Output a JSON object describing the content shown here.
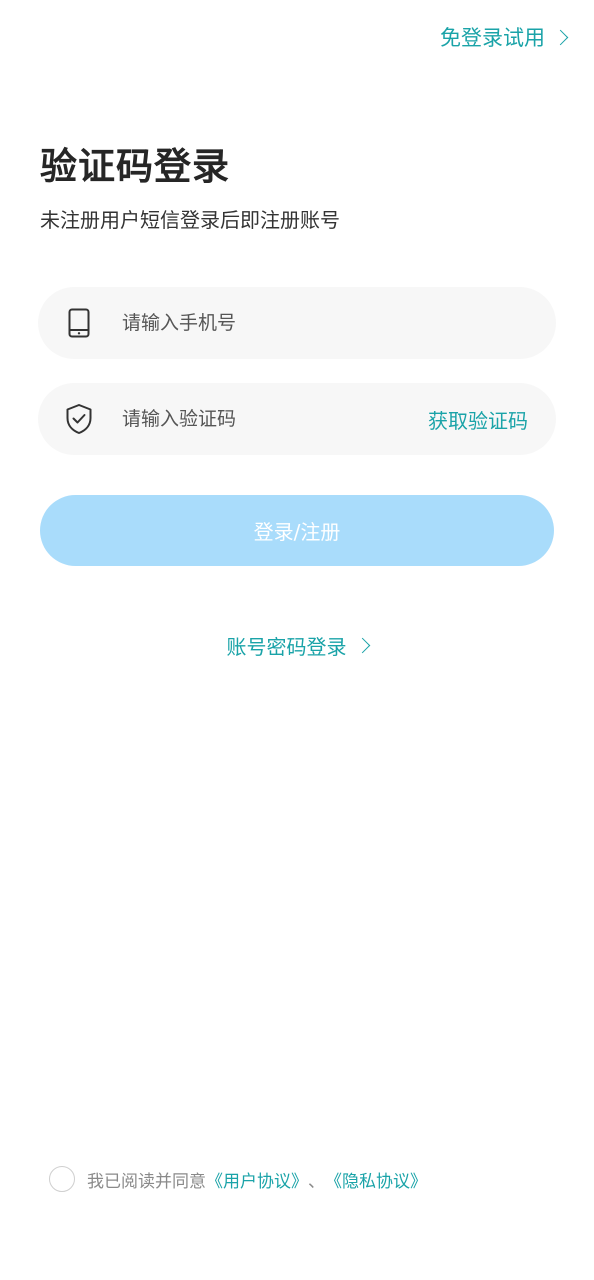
{
  "header": {
    "skip_login_label": "免登录试用"
  },
  "title": "验证码登录",
  "subtitle": "未注册用户短信登录后即注册账号",
  "form": {
    "phone_placeholder": "请输入手机号",
    "code_placeholder": "请输入验证码",
    "get_code_label": "获取验证码",
    "submit_label": "登录/注册"
  },
  "alt_login_label": "账号密码登录",
  "agreement": {
    "prefix": "我已阅读并同意",
    "user_agreement": "《用户协议》",
    "separator": "、",
    "privacy_policy": "《隐私协议》",
    "checked": false
  },
  "icons": {
    "phone": "phone-icon",
    "shield": "shield-check-icon",
    "chevron": "chevron-right-icon"
  },
  "colors": {
    "accent": "#1aa3a8",
    "button_disabled": "#a9dcfb",
    "field_background": "#f7f7f7"
  }
}
